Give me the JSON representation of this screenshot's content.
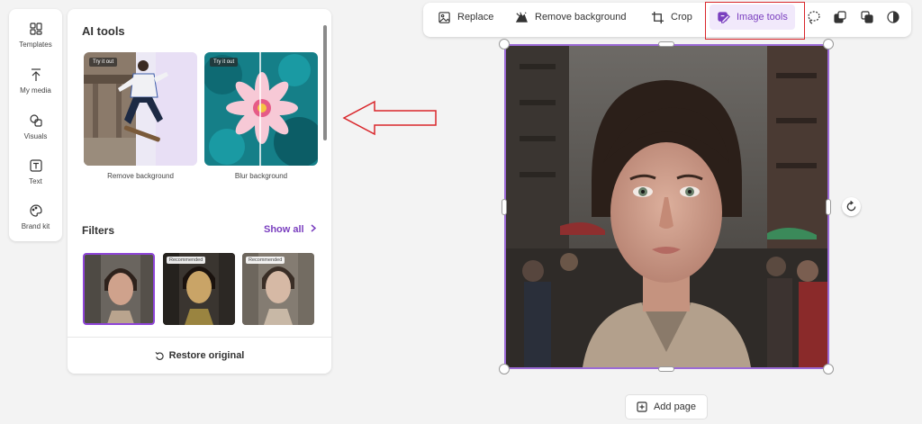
{
  "rail": {
    "items": [
      {
        "label": "Templates",
        "icon": "templates-icon"
      },
      {
        "label": "My media",
        "icon": "upload-icon"
      },
      {
        "label": "Visuals",
        "icon": "shapes-icon"
      },
      {
        "label": "Text",
        "icon": "text-icon"
      },
      {
        "label": "Brand kit",
        "icon": "brand-kit-icon"
      }
    ]
  },
  "panel": {
    "title": "AI tools",
    "cards": [
      {
        "badge": "Try it out",
        "caption": "Remove background"
      },
      {
        "badge": "Try it out",
        "caption": "Blur background"
      }
    ],
    "filters_title": "Filters",
    "show_all": "Show all",
    "filters": [
      {
        "badge": "",
        "selected": true
      },
      {
        "badge": "Recommended",
        "selected": false
      },
      {
        "badge": "Recommended",
        "selected": false
      }
    ],
    "restore": "Restore original"
  },
  "toolbar": {
    "replace": "Replace",
    "remove_bg": "Remove background",
    "crop": "Crop",
    "image_tools": "Image tools",
    "icons": [
      "lasso-icon",
      "layers-icon",
      "arrange-icon",
      "contrast-icon"
    ]
  },
  "colors": {
    "accent": "#7a3fbf",
    "selection": "#9b6ad6",
    "annotation": "#d9262b"
  },
  "canvas": {
    "add_page": "Add page"
  }
}
